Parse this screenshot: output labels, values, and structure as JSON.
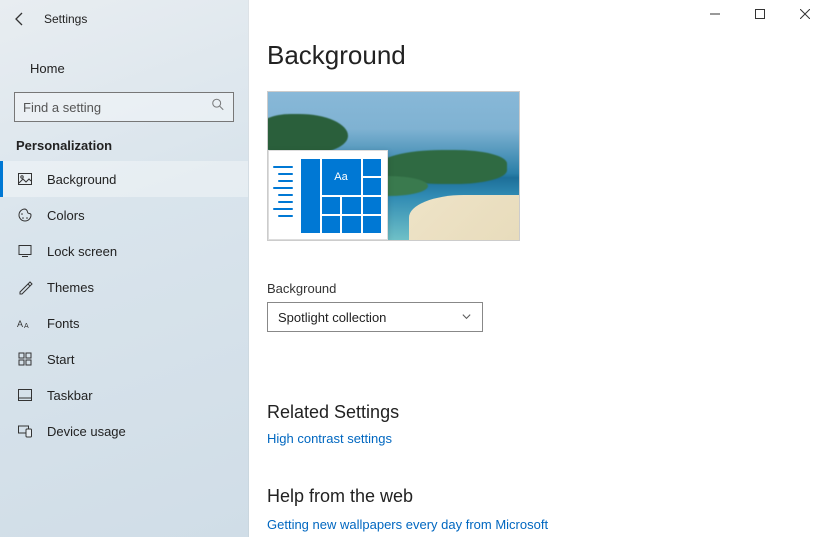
{
  "app": {
    "title": "Settings"
  },
  "sidebar": {
    "home": "Home",
    "search_placeholder": "Find a setting",
    "category": "Personalization",
    "items": [
      {
        "label": "Background"
      },
      {
        "label": "Colors"
      },
      {
        "label": "Lock screen"
      },
      {
        "label": "Themes"
      },
      {
        "label": "Fonts"
      },
      {
        "label": "Start"
      },
      {
        "label": "Taskbar"
      },
      {
        "label": "Device usage"
      }
    ]
  },
  "main": {
    "title": "Background",
    "preview_tile_text": "Aa",
    "bg_label": "Background",
    "bg_value": "Spotlight collection",
    "related_head": "Related Settings",
    "related_link": "High contrast settings",
    "help_head": "Help from the web",
    "help_link1": "Getting new wallpapers every day from Microsoft"
  }
}
